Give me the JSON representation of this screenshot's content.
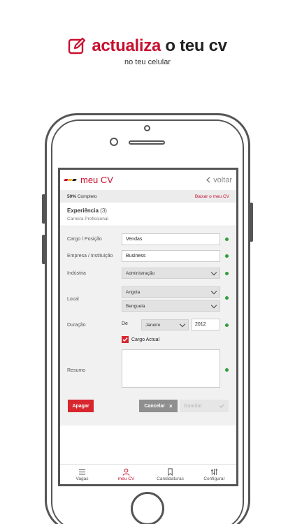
{
  "promo": {
    "title_accent": "actualiza",
    "title_rest": "o teu cv",
    "subtitle": "no teu celular"
  },
  "app": {
    "title": "meu CV",
    "back_label": "voltar"
  },
  "progress": {
    "percent": "50%",
    "label": "Completo",
    "download_link": "Baixar o meu CV"
  },
  "section": {
    "title": "Experiência",
    "count": "(3)",
    "subtitle": "Carreira Profissional"
  },
  "form": {
    "cargo": {
      "label": "Cargo / Posição",
      "value": "Vendas"
    },
    "empresa": {
      "label": "Empresa / Instituição",
      "value": "Business"
    },
    "industria": {
      "label": "Indústria",
      "value": "Administração"
    },
    "local": {
      "label": "Local",
      "country": "Angola",
      "city": "Benguela"
    },
    "duracao": {
      "label": "Duração",
      "from_label": "De",
      "month": "Janeiro",
      "year": "2012"
    },
    "cargo_actual": {
      "label": "Cargo Actual",
      "checked": true
    },
    "resumo": {
      "label": "Resumo",
      "value": ""
    }
  },
  "actions": {
    "delete": "Apagar",
    "cancel": "Cancelar",
    "save": "Guardar"
  },
  "tabs": [
    {
      "label": "Vagas",
      "icon": "menu-icon"
    },
    {
      "label": "meu CV",
      "icon": "user-icon",
      "active": true
    },
    {
      "label": "Candidaturas",
      "icon": "bookmark-icon"
    },
    {
      "label": "Configurar",
      "icon": "sliders-icon"
    }
  ],
  "colors": {
    "brand": "#c8102e",
    "status_ok": "#2e9e3a",
    "delete": "#d7262e",
    "cancel": "#8f8f8f"
  }
}
